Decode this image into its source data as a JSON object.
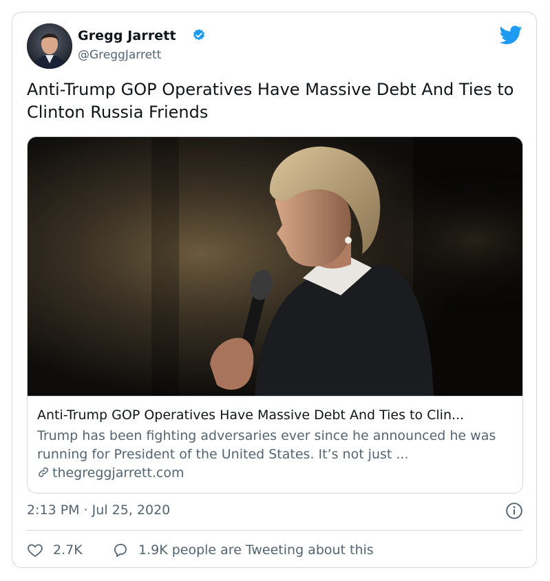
{
  "author": {
    "name": "Gregg Jarrett",
    "handle": "@GreggJarrett",
    "verified": true
  },
  "tweet": {
    "text": "Anti-Trump GOP Operatives Have Massive Debt And Ties to Clinton Russia Friends",
    "timestamp": "2:13 PM · Jul 25, 2020"
  },
  "link_card": {
    "title": "Anti-Trump GOP Operatives Have Massive Debt And Ties to Clin...",
    "description": "Trump has been fighting adversaries ever since he announced he was running for President of the United States. It’s not just ...",
    "domain": "thegreggjarrett.com"
  },
  "stats": {
    "likes": "2.7K",
    "tweeting": "1.9K people are Tweeting about this"
  },
  "colors": {
    "brand_blue": "#1d9bf0",
    "secondary_text": "#536471",
    "border": "#cfd9de"
  },
  "icons": [
    "verified-badge-icon",
    "twitter-bird-icon",
    "link-icon",
    "info-icon",
    "heart-icon",
    "reply-bubble-icon"
  ]
}
